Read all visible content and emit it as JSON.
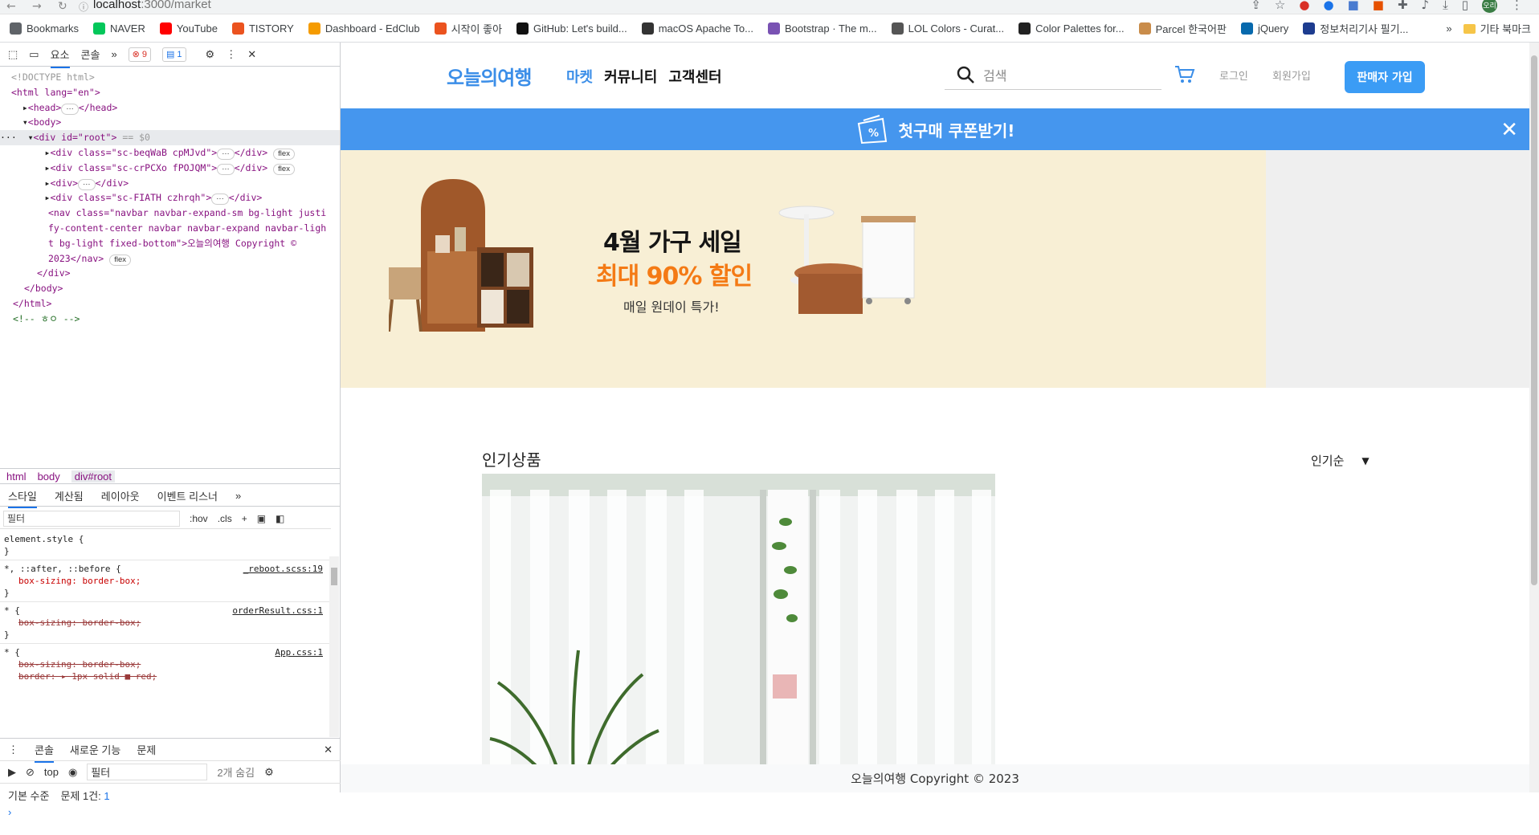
{
  "browser": {
    "url_host": "localhost",
    "url_path": ":3000/market",
    "avatar": "오리"
  },
  "bookmarks": [
    {
      "label": "Bookmarks",
      "icon": "star-icon",
      "color": "#5f6368"
    },
    {
      "label": "NAVER",
      "icon": "naver-icon",
      "color": "#03c75a"
    },
    {
      "label": "YouTube",
      "icon": "youtube-icon",
      "color": "#ff0000"
    },
    {
      "label": "TISTORY",
      "icon": "tistory-icon",
      "color": "#eb531f"
    },
    {
      "label": "Dashboard - EdClub",
      "icon": "edclub-icon",
      "color": "#f59b00"
    },
    {
      "label": "시작이 좋아",
      "icon": "tistory-icon",
      "color": "#eb531f"
    },
    {
      "label": "GitHub: Let's build...",
      "icon": "github-icon",
      "color": "#111111"
    },
    {
      "label": "macOS Apache To...",
      "icon": "dots-icon",
      "color": "#333333"
    },
    {
      "label": "Bootstrap · The m...",
      "icon": "bootstrap-icon",
      "color": "#7952b3"
    },
    {
      "label": "LOL Colors - Curat...",
      "icon": "lol-icon",
      "color": "#555555"
    },
    {
      "label": "Color Palettes for...",
      "icon": "palette-icon",
      "color": "#222222"
    },
    {
      "label": "Parcel 한국어판",
      "icon": "parcel-icon",
      "color": "#c98c4a"
    },
    {
      "label": "jQuery",
      "icon": "jquery-icon",
      "color": "#0769ad"
    },
    {
      "label": "정보처리기사 필기...",
      "icon": "gsc-icon",
      "color": "#1d3c8f"
    }
  ],
  "bookmarks_more": "»",
  "bookmarks_other": "기타 북마크",
  "devtools": {
    "tabs": [
      "요소",
      "콘솔"
    ],
    "errors": "9",
    "messages": "1",
    "dom": {
      "doctype": "<!DOCTYPE html>",
      "html_open": "<html lang=\"en\">",
      "head": "<head>",
      "head_close": "</head>",
      "body_open": "<body>",
      "root": "<div id=\"root\">",
      "root_suffix": " == $0",
      "div1": "<div class=\"sc-beqWaB cpMJvd\">",
      "div2": "<div class=\"sc-crPCXo fPOJQM\">",
      "div3": "<div>",
      "div4": "<div class=\"sc-FIATH czhrqh\">",
      "div_close": "</div>",
      "nav1": "<nav class=\"navbar navbar-expand-sm bg-light justi",
      "nav2": "fy-content-center navbar navbar-expand navbar-ligh",
      "nav3": "t bg-light fixed-bottom\">오늘의여행 Copyright ©",
      "nav4": "2023</nav>",
      "flex": "flex",
      "root_close": "</div>",
      "body_close": "</body>",
      "html_close": "</html>",
      "comment": "<!-- ㅎㅇ -->"
    },
    "breadcrumbs": [
      "html",
      "body",
      "div#root"
    ],
    "subtabs": [
      "스타일",
      "계산됨",
      "레이아웃",
      "이벤트 리스너"
    ],
    "filter_placeholder": "필터",
    "hov": ":hov",
    "cls": ".cls",
    "styles": {
      "element_style": "element.style {",
      "close": "}",
      "rule1_sel": "*, ::after, ::before {",
      "rule1_src": "_reboot.scss:19",
      "rule1_prop": "box-sizing: border-box;",
      "rule2_sel": "* {",
      "rule2_src": "orderResult.css:1",
      "rule2_prop": "box-sizing: border-box;",
      "rule3_sel": "* {",
      "rule3_src": "App.css:1",
      "rule3_prop1": "box-sizing: border-box;",
      "rule3_prop2": "border: ▸ 1px solid ■ red;"
    },
    "console": {
      "tabs": [
        "콘솔",
        "새로운 기능",
        "문제"
      ],
      "context": "top",
      "filter": "필터",
      "hidden": "2개 숨김",
      "level": "기본 수준",
      "issues": "문제 1건:",
      "issues_count": "1"
    }
  },
  "site": {
    "logo": "오늘의여행",
    "nav": [
      "마켓",
      "커뮤니티",
      "고객센터"
    ],
    "search_placeholder": "검색",
    "login": "로그인",
    "signup": "회원가입",
    "seller_button": "판매자 가입",
    "coupon_text": "첫구매 쿠폰받기!",
    "banner": {
      "line1": "4월 가구 세일",
      "line2": "최대 90% 할인",
      "line3": "매일 원데이 특가!"
    },
    "section_title": "인기상품",
    "sort_value": "인기순",
    "footer": "오늘의여행 Copyright © 2023",
    "colors": {
      "primary": "#3b8ee8",
      "banner_bg": "#f8efd5",
      "sale_orange": "#f47a15"
    }
  }
}
